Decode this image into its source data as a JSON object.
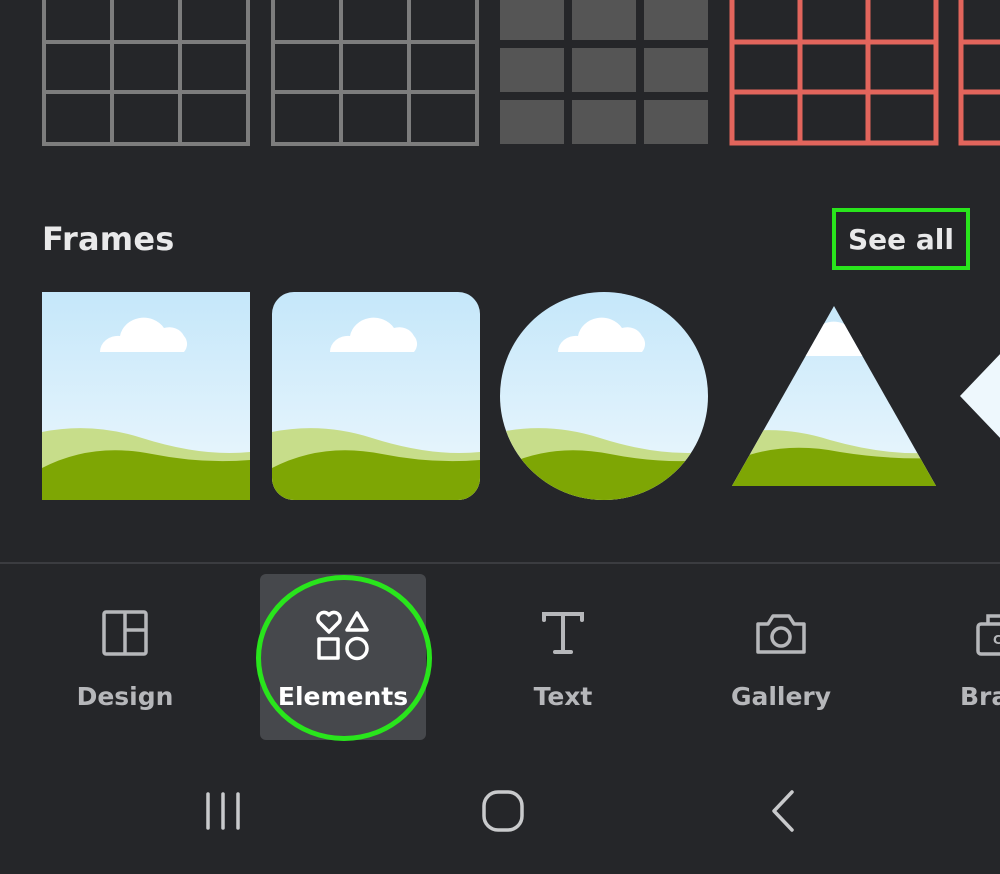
{
  "layout_grids": {
    "items": [
      {
        "name": "grid-3x3-outline",
        "color": "#7d7d7d"
      },
      {
        "name": "grid-3x3-outline",
        "color": "#7d7d7d"
      },
      {
        "name": "grid-3x3-filled",
        "color": "#555555"
      },
      {
        "name": "grid-3x3-outline",
        "color": "#e2655c"
      }
    ]
  },
  "frames": {
    "title": "Frames",
    "see_all_label": "See all",
    "items": [
      {
        "shape": "square"
      },
      {
        "shape": "rounded-square"
      },
      {
        "shape": "circle"
      },
      {
        "shape": "triangle"
      },
      {
        "shape": "diamond"
      }
    ]
  },
  "bottom_nav": {
    "items": [
      {
        "label": "Design",
        "icon": "design-layout-icon"
      },
      {
        "label": "Elements",
        "icon": "elements-shapes-icon",
        "active": true
      },
      {
        "label": "Text",
        "icon": "text-t-icon"
      },
      {
        "label": "Gallery",
        "icon": "camera-icon"
      },
      {
        "label": "Bra",
        "icon": "brand-kit-icon"
      }
    ]
  },
  "system_nav": {
    "buttons": [
      "recent-apps",
      "home",
      "back"
    ]
  },
  "colors": {
    "background": "#252629",
    "highlight": "#29e51c",
    "sky": "#d6eefb",
    "grass_dark": "#7ea604",
    "grass_light": "#c7dd8a"
  }
}
